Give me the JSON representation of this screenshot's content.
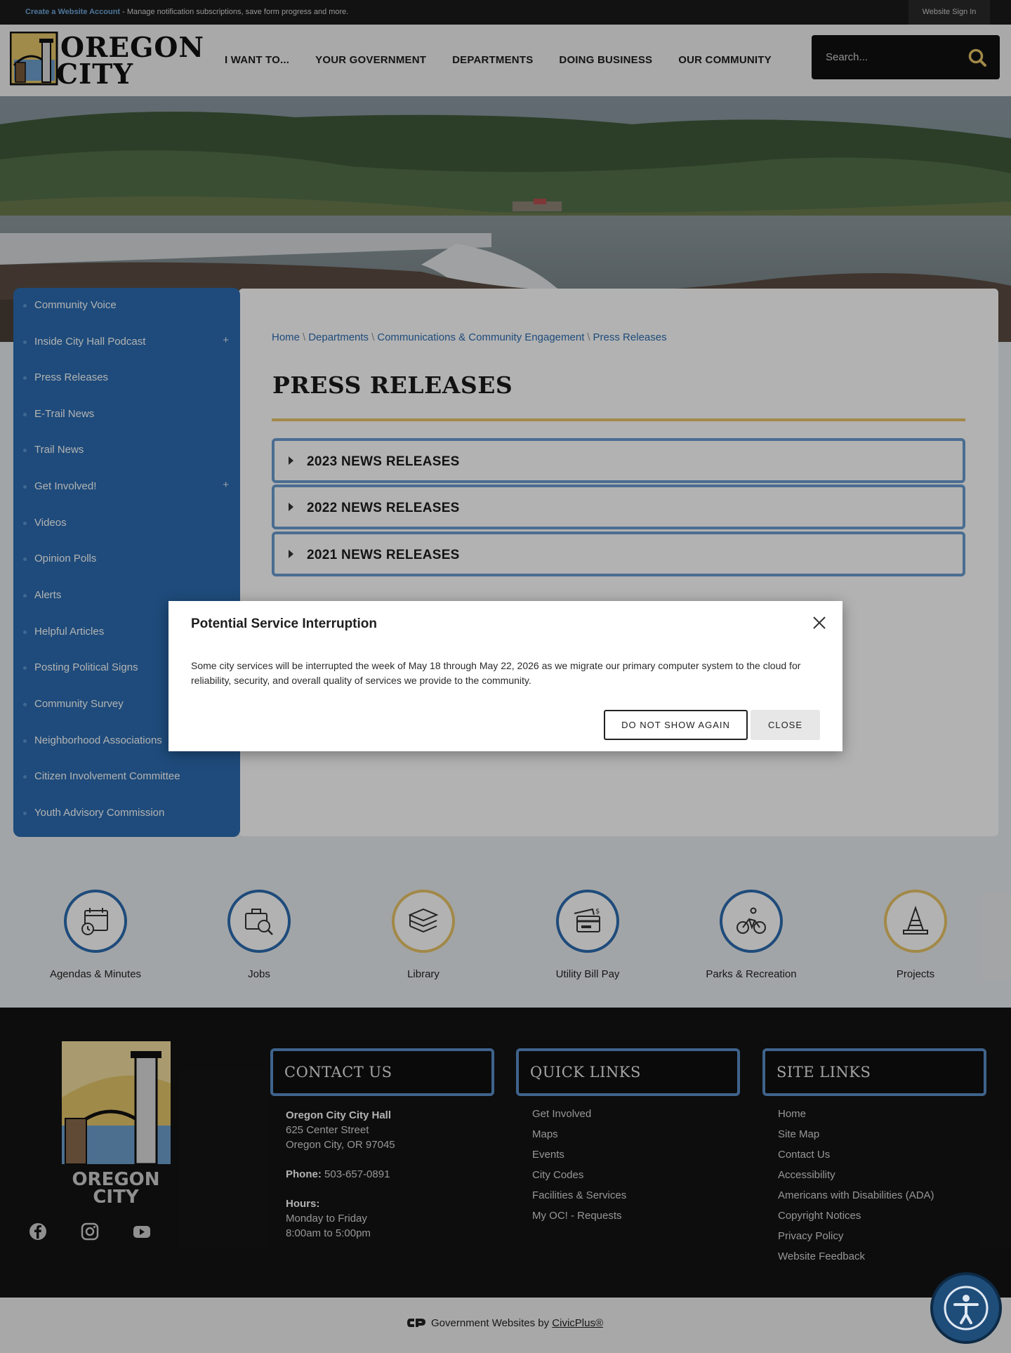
{
  "topbar": {
    "create_account": "Create a Website Account",
    "manage_text": " - Manage notification subscriptions, save form progress and more.",
    "sign_in": "Website Sign In"
  },
  "header": {
    "logo_line1": "OREGON",
    "logo_line2": "CITY",
    "nav": [
      "I WANT TO...",
      "YOUR GOVERNMENT",
      "DEPARTMENTS",
      "DOING BUSINESS",
      "OUR COMMUNITY"
    ],
    "search_placeholder": "Search...",
    "search_icon": "search-icon"
  },
  "sidebar": {
    "items": [
      {
        "label": "Community Voice",
        "expandable": false
      },
      {
        "label": "Inside City Hall Podcast",
        "expandable": true
      },
      {
        "label": "Press Releases",
        "expandable": false
      },
      {
        "label": "E-Trail News",
        "expandable": false
      },
      {
        "label": "Trail News",
        "expandable": false
      },
      {
        "label": "Get Involved!",
        "expandable": true
      },
      {
        "label": "Videos",
        "expandable": false
      },
      {
        "label": "Opinion Polls",
        "expandable": false
      },
      {
        "label": "Alerts",
        "expandable": false
      },
      {
        "label": "Helpful Articles",
        "expandable": false
      },
      {
        "label": "Posting Political Signs",
        "expandable": false
      },
      {
        "label": "Community Survey",
        "expandable": false
      },
      {
        "label": "Neighborhood Associations",
        "expandable": false
      },
      {
        "label": "Citizen Involvement Committee",
        "expandable": false
      },
      {
        "label": "Youth Advisory Commission",
        "expandable": false
      }
    ],
    "plus_symbol": "+"
  },
  "breadcrumb": [
    "Home",
    "Departments",
    "Communications & Community Engagement",
    "Press Releases"
  ],
  "breadcrumb_separator": "\\",
  "page_title": "PRESS RELEASES",
  "accordions": [
    "2023 NEWS RELEASES",
    "2022 NEWS RELEASES",
    "2021 NEWS RELEASES"
  ],
  "quick_links": [
    {
      "label": "Agendas & Minutes",
      "icon": "calendar-clock-icon",
      "accent": "blue"
    },
    {
      "label": "Jobs",
      "icon": "briefcase-search-icon",
      "accent": "blue"
    },
    {
      "label": "Library",
      "icon": "books-icon",
      "accent": "gold"
    },
    {
      "label": "Utility Bill Pay",
      "icon": "bill-pay-icon",
      "accent": "blue"
    },
    {
      "label": "Parks & Recreation",
      "icon": "cyclist-icon",
      "accent": "blue"
    },
    {
      "label": "Projects",
      "icon": "traffic-cone-icon",
      "accent": "gold"
    }
  ],
  "footer": {
    "logo_line1": "OREGON",
    "logo_line2": "CITY",
    "contact_heading": "CONTACT US",
    "quick_heading": "QUICK LINKS",
    "site_heading": "SITE LINKS",
    "contact": {
      "name": "Oregon City City Hall",
      "street": "625 Center Street",
      "city": "Oregon City, OR 97045",
      "phone_label": "Phone:",
      "phone": "503-657-0891",
      "hours_label": "Hours:",
      "hours_days": "Monday to Friday",
      "hours_time": "8:00am to 5:00pm"
    },
    "quick_links": [
      "Get Involved",
      "Maps",
      "Events",
      "City Codes",
      "Facilities & Services",
      "My OC! - Requests"
    ],
    "site_links": [
      "Home",
      "Site Map",
      "Contact Us",
      "Accessibility",
      "Americans with Disabilities (ADA)",
      "Copyright Notices",
      "Privacy Policy",
      "Website Feedback"
    ],
    "social": [
      "facebook-icon",
      "instagram-icon",
      "youtube-icon"
    ]
  },
  "credit": {
    "text": "Government Websites by ",
    "link": "CivicPlus®"
  },
  "modal": {
    "title": "Potential Service Interruption",
    "body": "Some city services will be interrupted the week of May 18 through May 22, 2026 as we migrate our primary computer system to the cloud for reliability, security, and overall quality of services we provide to the community.",
    "do_not_show": "DO NOT SHOW AGAIN",
    "close": "CLOSE"
  },
  "colors": {
    "brand_blue": "#2b6cb0",
    "accent_gold": "#e9c468",
    "dark": "#141414"
  }
}
